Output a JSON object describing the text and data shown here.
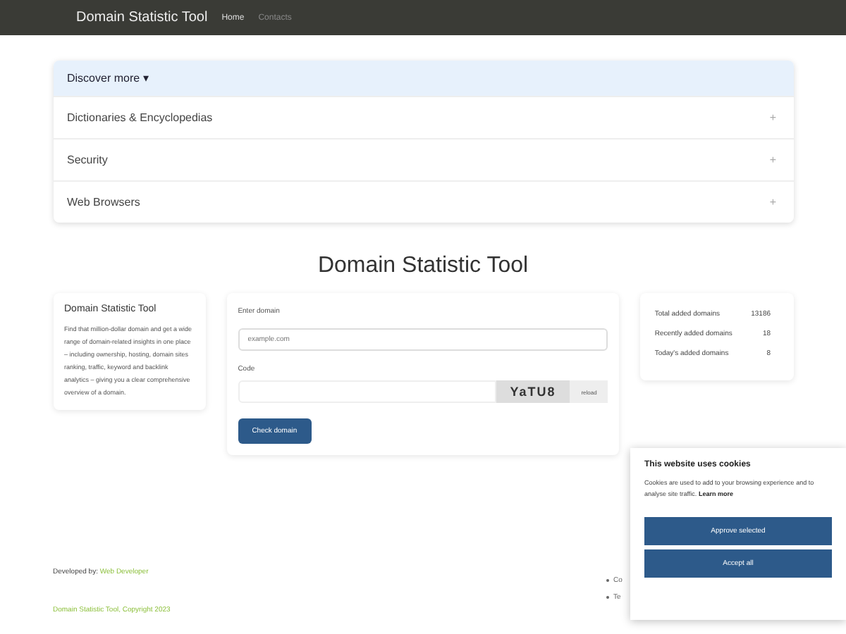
{
  "navbar": {
    "brand": "Domain Statistic Tool",
    "links": [
      {
        "label": "Home",
        "selected": true
      },
      {
        "label": "Contacts",
        "selected": false
      }
    ]
  },
  "discover": {
    "title": "Discover more ▾",
    "items": [
      {
        "label": "Dictionaries & Encyclopedias",
        "icon": "+"
      },
      {
        "label": "Security",
        "icon": "+"
      },
      {
        "label": "Web Browsers",
        "icon": "+"
      }
    ]
  },
  "heading": "Domain Statistic Tool",
  "about": {
    "title": "Domain Statistic Tool",
    "text": "Find that million-dollar domain and get a wide range of domain-related insights in one place – including ownership, hosting, domain sites ranking, traffic, keyword and backlink analytics – giving you a clear comprehensive overview of a domain."
  },
  "form": {
    "domain_label": "Enter domain",
    "domain_placeholder": "example.com",
    "code_label": "Code",
    "captcha": "YaTU8",
    "reload": "reload",
    "submit": "Check domain"
  },
  "stats": [
    {
      "label": "Total added domains",
      "value": "13186"
    },
    {
      "label": "Recently added domains",
      "value": "18"
    },
    {
      "label": "Today's added domains",
      "value": "8"
    }
  ],
  "footer": {
    "developed_by": "Developed by:",
    "developer": "Web Developer",
    "copyright": "Domain Statistic Tool, Copyright 2023",
    "links": [
      "Co",
      "Te"
    ]
  },
  "cookie": {
    "title": "This website uses cookies",
    "text": "Cookies are used to add to your browsing experience and to analyse site traffic.",
    "learn_more": "Learn more",
    "buttons": [
      "Approve selected",
      "Accept all"
    ]
  }
}
